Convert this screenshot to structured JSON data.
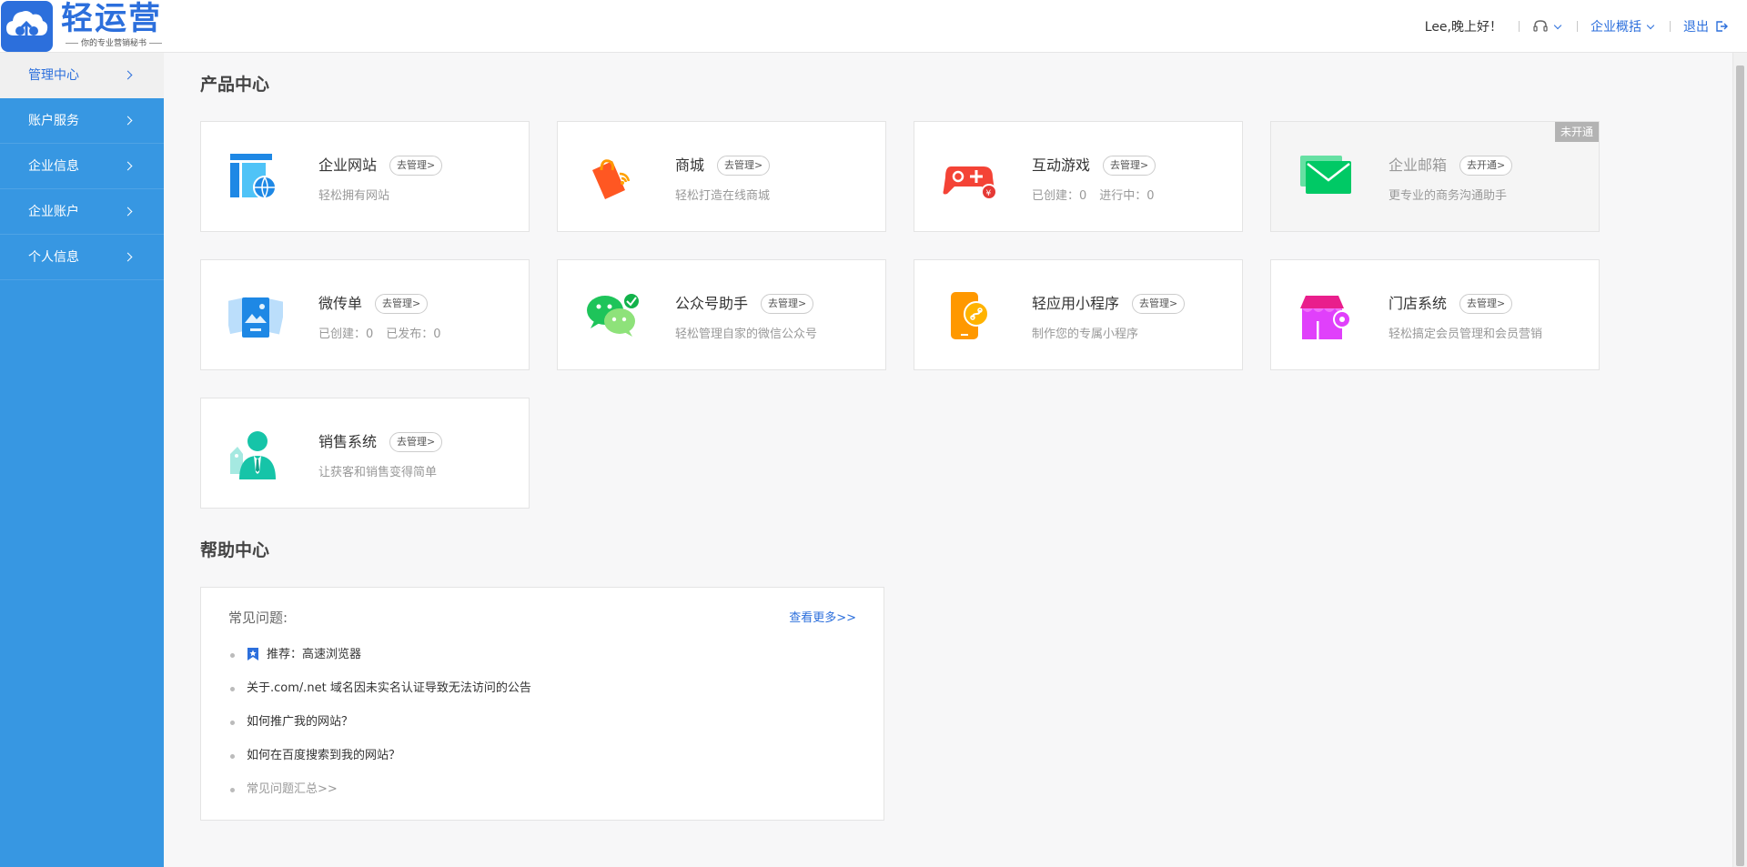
{
  "header": {
    "logo_title": "轻运营",
    "logo_subtitle": "你的专业营销秘书",
    "greeting": "Lee,晚上好！",
    "enterprise_menu": "企业概括",
    "logout": "退出"
  },
  "sidebar": {
    "items": [
      {
        "label": "管理中心",
        "active": true
      },
      {
        "label": "账户服务"
      },
      {
        "label": "企业信息"
      },
      {
        "label": "企业账户"
      },
      {
        "label": "个人信息"
      }
    ]
  },
  "products": {
    "title": "产品中心",
    "cards": [
      {
        "name": "企业网站",
        "button": "去管理>",
        "desc": "轻松拥有网站",
        "icon": "website-icon"
      },
      {
        "name": "商城",
        "button": "去管理>",
        "desc": "轻松打造在线商城",
        "icon": "shopping-bag-icon"
      },
      {
        "name": "互动游戏",
        "button": "去管理>",
        "desc_a": "已创建：0",
        "desc_b": "进行中：0",
        "icon": "gamepad-icon"
      },
      {
        "name": "企业邮箱",
        "button": "去开通>",
        "desc": "更专业的商务沟通助手",
        "badge": "未开通",
        "icon": "mail-icon"
      },
      {
        "name": "微传单",
        "button": "去管理>",
        "desc_a": "已创建：0",
        "desc_b": "已发布：0",
        "icon": "flyer-icon"
      },
      {
        "name": "公众号助手",
        "button": "去管理>",
        "desc": "轻松管理自家的微信公众号",
        "icon": "wechat-icon"
      },
      {
        "name": "轻应用小程序",
        "button": "去管理>",
        "desc": "制作您的专属小程序",
        "icon": "mini-program-icon"
      },
      {
        "name": "门店系统",
        "button": "去管理>",
        "desc": "轻松搞定会员管理和会员营销",
        "icon": "store-icon"
      },
      {
        "name": "销售系统",
        "button": "去管理>",
        "desc": "让获客和销售变得简单",
        "icon": "salesperson-icon"
      }
    ]
  },
  "help": {
    "title": "帮助中心",
    "faq_label": "常见问题:",
    "more": "查看更多>>",
    "items": [
      "推荐：高速浏览器",
      "关于.com/.net 域名因未实名认证导致无法访问的公告",
      "如何推广我的网站？",
      "如何在百度搜索到我的网站？",
      "常见问题汇总>>"
    ]
  },
  "colors": {
    "brand": "#2c6fdc",
    "sidebar": "#3797e2"
  }
}
